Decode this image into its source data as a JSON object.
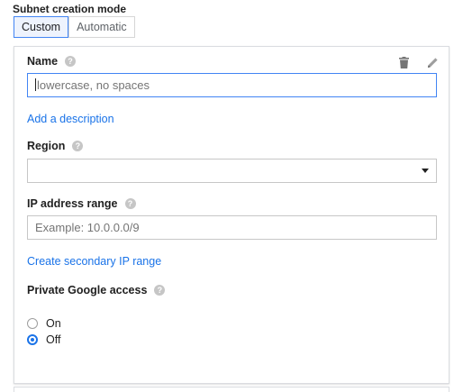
{
  "subnet_mode": {
    "title": "Subnet creation mode",
    "options": [
      "Custom",
      "Automatic"
    ],
    "selected": "Custom"
  },
  "form": {
    "name": {
      "label": "Name",
      "placeholder": "lowercase, no spaces",
      "value": ""
    },
    "add_description_link": "Add a description",
    "region": {
      "label": "Region",
      "value": ""
    },
    "ip_range": {
      "label": "IP address range",
      "placeholder": "Example: 10.0.0.0/9",
      "value": ""
    },
    "secondary_ip_link": "Create secondary IP range",
    "private_access": {
      "label": "Private Google access",
      "options": [
        "On",
        "Off"
      ],
      "selected": "Off"
    },
    "help_icon_glyph": "?"
  },
  "icons": {
    "delete": "trash-icon",
    "edit": "pencil-icon",
    "help": "help-icon",
    "dropdown": "chevron-down-icon"
  },
  "colors": {
    "accent": "#1a73e8",
    "focus_border": "#4285f4",
    "help_gray": "#c6c6c6"
  }
}
